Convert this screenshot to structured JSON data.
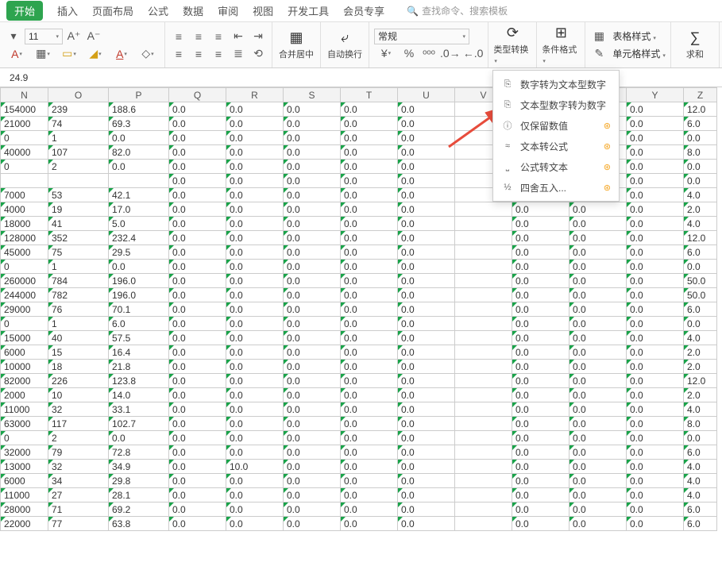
{
  "tabs": {
    "items": [
      "开始",
      "插入",
      "页面布局",
      "公式",
      "数据",
      "审阅",
      "视图",
      "开发工具",
      "会员专享"
    ],
    "active": 0,
    "search_placeholder": "查找命令、搜索模板"
  },
  "ribbon": {
    "font_size": "11",
    "merge_label": "合并居中",
    "wrap_label": "自动换行",
    "number_format": "常规",
    "type_convert_label": "类型转换",
    "cond_format_label": "条件格式",
    "table_style_label": "表格样式",
    "cell_style_label": "单元格样式",
    "sum_label": "求和"
  },
  "formula_bar": {
    "value": "24.9"
  },
  "menu": {
    "items": [
      {
        "icon": "⎘",
        "label": "数字转为文本型数字",
        "badge": ""
      },
      {
        "icon": "⎘",
        "label": "文本型数字转为数字",
        "badge": ""
      },
      {
        "icon": "ⓘ",
        "label": "仅保留数值",
        "badge": "⊛"
      },
      {
        "icon": "≈",
        "label": "文本转公式",
        "badge": "⊛"
      },
      {
        "icon": "⎵",
        "label": "公式转文本",
        "badge": "⊛"
      },
      {
        "icon": "½",
        "label": "四舍五入...",
        "badge": "⊛"
      }
    ]
  },
  "columns": [
    "N",
    "O",
    "P",
    "Q",
    "R",
    "S",
    "T",
    "U",
    "V",
    "W",
    "X",
    "Y",
    "Z"
  ],
  "chart_data": {
    "type": "table",
    "columns": [
      "N",
      "O",
      "P",
      "Q",
      "R",
      "S",
      "T",
      "U",
      "V",
      "W",
      "X",
      "Y",
      "Z"
    ],
    "rows": [
      [
        "154000",
        "239",
        "188.6",
        "0.0",
        "0.0",
        "0.0",
        "0.0",
        "0.0",
        "",
        "",
        "",
        "0.0",
        "12.0"
      ],
      [
        "21000",
        "74",
        "69.3",
        "0.0",
        "0.0",
        "0.0",
        "0.0",
        "0.0",
        "",
        "",
        "",
        "0.0",
        "6.0"
      ],
      [
        "0",
        "1",
        "0.0",
        "0.0",
        "0.0",
        "0.0",
        "0.0",
        "0.0",
        "",
        "",
        "",
        "0.0",
        "0.0"
      ],
      [
        "40000",
        "107",
        "82.0",
        "0.0",
        "0.0",
        "0.0",
        "0.0",
        "0.0",
        "",
        "",
        "",
        "0.0",
        "8.0"
      ],
      [
        "0",
        "2",
        "0.0",
        "0.0",
        "0.0",
        "0.0",
        "0.0",
        "0.0",
        "",
        "",
        "",
        "0.0",
        "0.0"
      ],
      [
        "",
        "",
        "",
        "0.0",
        "0.0",
        "0.0",
        "0.0",
        "0.0",
        "",
        "0.0",
        "0.0",
        "0.0",
        "0.0"
      ],
      [
        "7000",
        "53",
        "42.1",
        "0.0",
        "0.0",
        "0.0",
        "0.0",
        "0.0",
        "",
        "0.0",
        "0.0",
        "0.0",
        "4.0"
      ],
      [
        "4000",
        "19",
        "17.0",
        "0.0",
        "0.0",
        "0.0",
        "0.0",
        "0.0",
        "",
        "0.0",
        "0.0",
        "0.0",
        "2.0"
      ],
      [
        "18000",
        "41",
        "5.0",
        "0.0",
        "0.0",
        "0.0",
        "0.0",
        "0.0",
        "",
        "0.0",
        "0.0",
        "0.0",
        "4.0"
      ],
      [
        "128000",
        "352",
        "232.4",
        "0.0",
        "0.0",
        "0.0",
        "0.0",
        "0.0",
        "",
        "0.0",
        "0.0",
        "0.0",
        "12.0"
      ],
      [
        "45000",
        "75",
        "29.5",
        "0.0",
        "0.0",
        "0.0",
        "0.0",
        "0.0",
        "",
        "0.0",
        "0.0",
        "0.0",
        "6.0"
      ],
      [
        "0",
        "1",
        "0.0",
        "0.0",
        "0.0",
        "0.0",
        "0.0",
        "0.0",
        "",
        "0.0",
        "0.0",
        "0.0",
        "0.0"
      ],
      [
        "260000",
        "784",
        "196.0",
        "0.0",
        "0.0",
        "0.0",
        "0.0",
        "0.0",
        "",
        "0.0",
        "0.0",
        "0.0",
        "50.0"
      ],
      [
        "244000",
        "782",
        "196.0",
        "0.0",
        "0.0",
        "0.0",
        "0.0",
        "0.0",
        "",
        "0.0",
        "0.0",
        "0.0",
        "50.0"
      ],
      [
        "29000",
        "76",
        "70.1",
        "0.0",
        "0.0",
        "0.0",
        "0.0",
        "0.0",
        "",
        "0.0",
        "0.0",
        "0.0",
        "6.0"
      ],
      [
        "0",
        "1",
        "6.0",
        "0.0",
        "0.0",
        "0.0",
        "0.0",
        "0.0",
        "",
        "0.0",
        "0.0",
        "0.0",
        "0.0"
      ],
      [
        "15000",
        "40",
        "57.5",
        "0.0",
        "0.0",
        "0.0",
        "0.0",
        "0.0",
        "",
        "0.0",
        "0.0",
        "0.0",
        "4.0"
      ],
      [
        "6000",
        "15",
        "16.4",
        "0.0",
        "0.0",
        "0.0",
        "0.0",
        "0.0",
        "",
        "0.0",
        "0.0",
        "0.0",
        "2.0"
      ],
      [
        "10000",
        "18",
        "21.8",
        "0.0",
        "0.0",
        "0.0",
        "0.0",
        "0.0",
        "",
        "0.0",
        "0.0",
        "0.0",
        "2.0"
      ],
      [
        "82000",
        "226",
        "123.8",
        "0.0",
        "0.0",
        "0.0",
        "0.0",
        "0.0",
        "",
        "0.0",
        "0.0",
        "0.0",
        "12.0"
      ],
      [
        "2000",
        "10",
        "14.0",
        "0.0",
        "0.0",
        "0.0",
        "0.0",
        "0.0",
        "",
        "0.0",
        "0.0",
        "0.0",
        "2.0"
      ],
      [
        "11000",
        "32",
        "33.1",
        "0.0",
        "0.0",
        "0.0",
        "0.0",
        "0.0",
        "",
        "0.0",
        "0.0",
        "0.0",
        "4.0"
      ],
      [
        "63000",
        "117",
        "102.7",
        "0.0",
        "0.0",
        "0.0",
        "0.0",
        "0.0",
        "",
        "0.0",
        "0.0",
        "0.0",
        "8.0"
      ],
      [
        "0",
        "2",
        "0.0",
        "0.0",
        "0.0",
        "0.0",
        "0.0",
        "0.0",
        "",
        "0.0",
        "0.0",
        "0.0",
        "0.0"
      ],
      [
        "32000",
        "79",
        "72.8",
        "0.0",
        "0.0",
        "0.0",
        "0.0",
        "0.0",
        "",
        "0.0",
        "0.0",
        "0.0",
        "6.0"
      ],
      [
        "13000",
        "32",
        "34.9",
        "0.0",
        "10.0",
        "0.0",
        "0.0",
        "0.0",
        "",
        "0.0",
        "0.0",
        "0.0",
        "4.0"
      ],
      [
        "6000",
        "34",
        "29.8",
        "0.0",
        "0.0",
        "0.0",
        "0.0",
        "0.0",
        "",
        "0.0",
        "0.0",
        "0.0",
        "4.0"
      ],
      [
        "11000",
        "27",
        "28.1",
        "0.0",
        "0.0",
        "0.0",
        "0.0",
        "0.0",
        "",
        "0.0",
        "0.0",
        "0.0",
        "4.0"
      ],
      [
        "28000",
        "71",
        "69.2",
        "0.0",
        "0.0",
        "0.0",
        "0.0",
        "0.0",
        "",
        "0.0",
        "0.0",
        "0.0",
        "6.0"
      ],
      [
        "22000",
        "77",
        "63.8",
        "0.0",
        "0.0",
        "0.0",
        "0.0",
        "0.0",
        "",
        "0.0",
        "0.0",
        "0.0",
        "6.0"
      ]
    ]
  }
}
